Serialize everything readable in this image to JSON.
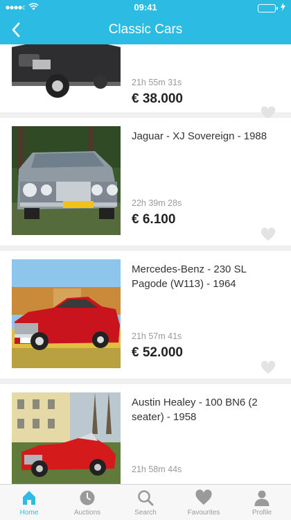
{
  "status": {
    "time": "09:41"
  },
  "nav": {
    "title": "Classic Cars"
  },
  "listings": [
    {
      "name": "",
      "timer": "21h 55m 31s",
      "price": "€ 38.000"
    },
    {
      "name": "Jaguar - XJ Sovereign - 1988",
      "timer": "22h 39m 28s",
      "price": "€ 6.100"
    },
    {
      "name": "Mercedes-Benz - 230 SL Pagode (W113) - 1964",
      "timer": "21h 57m 41s",
      "price": "€ 52.000"
    },
    {
      "name": "Austin Healey - 100 BN6 (2 seater) - 1958",
      "timer": "21h 58m 44s",
      "price": ""
    }
  ],
  "tabs": [
    {
      "label": "Home",
      "icon": "home-icon",
      "active": true
    },
    {
      "label": "Auctions",
      "icon": "clock-icon",
      "active": false
    },
    {
      "label": "Search",
      "icon": "search-icon",
      "active": false
    },
    {
      "label": "Favourites",
      "icon": "heart-icon",
      "active": false
    },
    {
      "label": "Profile",
      "icon": "person-icon",
      "active": false
    }
  ],
  "colors": {
    "accent": "#2bbbe3",
    "battery": "#4cd964",
    "tab_inactive": "#9a9a9a"
  }
}
